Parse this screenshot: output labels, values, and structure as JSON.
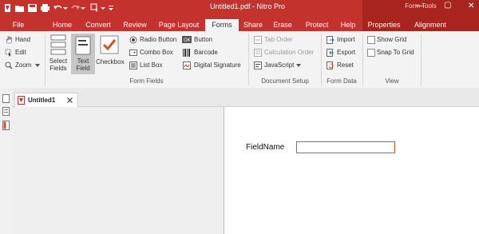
{
  "window": {
    "title": "Untitled1.pdf - Nitro Pro",
    "context_tab_group": "Form Tools",
    "controls": [
      "—",
      "▢",
      "✕"
    ]
  },
  "colors": {
    "accent": "#c4322e",
    "accent_dark": "#a7251e",
    "field_border": "#c85a2a"
  },
  "tabs": [
    {
      "label": "File"
    },
    {
      "label": "Home"
    },
    {
      "label": "Convert"
    },
    {
      "label": "Review"
    },
    {
      "label": "Page Layout"
    },
    {
      "label": "Forms",
      "active": true
    },
    {
      "label": "Share"
    },
    {
      "label": "Erase"
    },
    {
      "label": "Protect"
    },
    {
      "label": "Help"
    },
    {
      "label": "Properties"
    },
    {
      "label": "Alignment"
    }
  ],
  "ribbon": {
    "left_tools": {
      "hand": "Hand",
      "edit": "Edit",
      "zoom": "Zoom"
    },
    "form_fields": {
      "group_label": "Form Fields",
      "select_fields": "Select Fields",
      "text_field": "Text Field",
      "checkbox": "Checkbox",
      "radio_button": "Radio Button",
      "combo_box": "Combo Box",
      "list_box": "List Box",
      "button": "Button",
      "barcode": "Barcode",
      "digital_signature": "Digital Signature"
    },
    "document_setup": {
      "group_label": "Document Setup",
      "tab_order": "Tab Order",
      "calculation_order": "Calculation Order",
      "javascript": "JavaScript"
    },
    "form_data": {
      "group_label": "Form Data",
      "import": "Import",
      "export": "Export",
      "reset": "Reset"
    },
    "view": {
      "group_label": "View",
      "show_grid": "Show Grid",
      "snap_to_grid": "Snap To Grid"
    }
  },
  "document": {
    "tab_label": "Untitled1",
    "field_label": "FieldName"
  }
}
